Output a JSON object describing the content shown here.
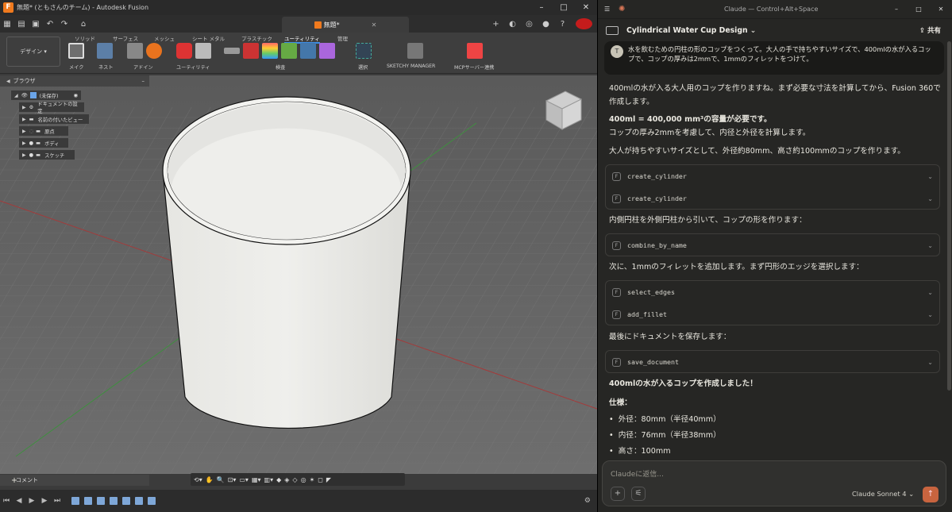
{
  "fusion": {
    "window_title": "無題* (ともさんのチーム) - Autodesk Fusion",
    "doc_tab": "無題*",
    "workspace": "デザイン",
    "toolbar_tabs": [
      "ソリッド",
      "サーフェス",
      "メッシュ",
      "シート メタル",
      "プラスチック",
      "ユーティリティ",
      "管理"
    ],
    "active_tab": "ユーティリティ",
    "groups": [
      "メイク",
      "ネスト",
      "アドイン",
      "ユーティリティ",
      "検査",
      "選択",
      "SKETCHY MANAGER",
      "MCPサーバー連携"
    ],
    "browser": {
      "title": "ブラウザ",
      "root": "(未保存)",
      "items": [
        "ドキュメントの設定",
        "名前の付いたビュー",
        "原点",
        "ボディ",
        "スケッチ"
      ]
    },
    "comment_label": "コメント"
  },
  "claude": {
    "window_title": "Claude — Control+Alt+Space",
    "conversation_title": "Cylindrical Water Cup Design",
    "share_label": "共有",
    "user_avatar": "T",
    "user_message": "水を飲むための円柱の形のコップをつくって。大人の手で持ちやすいサイズで、400mlの水が入るコップで、コップの厚みは2mmで、1mmのフィレットをつけて。",
    "p1": "400mlの水が入る大人用のコップを作りますね。まず必要な寸法を計算してから、Fusion 360で作成します。",
    "p2a": "400ml = 400,000 mm³の容量が必要です。",
    "p2b": "コップの厚み2mmを考慮して、内径と外径を計算します。",
    "p3": "大人が持ちやすいサイズとして、外径約80mm、高さ約100mmのコップを作ります。",
    "tools1": [
      "create_cylinder",
      "create_cylinder"
    ],
    "p4": "内側円柱を外側円柱から引いて、コップの形を作ります：",
    "tools2": [
      "combine_by_name"
    ],
    "p5": "次に、1mmのフィレットを追加します。まず円形のエッジを選択します：",
    "tools3": [
      "select_edges",
      "add_fillet"
    ],
    "p6": "最後にドキュメントを保存します：",
    "tools4": [
      "save_document"
    ],
    "p7": "400mlの水が入るコップを作成しました！",
    "spec_title": "仕様：",
    "specs": [
      "外径：80mm（半径40mm）",
      "内径：76mm（半径38mm）",
      "高さ：100mm"
    ],
    "input_placeholder": "Claudeに返信...",
    "model": "Claude Sonnet 4"
  },
  "colors": {
    "fusion_bg": "#3b3b3b",
    "claude_bg": "#262624",
    "accent": "#d97757",
    "send": "#c8643f"
  }
}
